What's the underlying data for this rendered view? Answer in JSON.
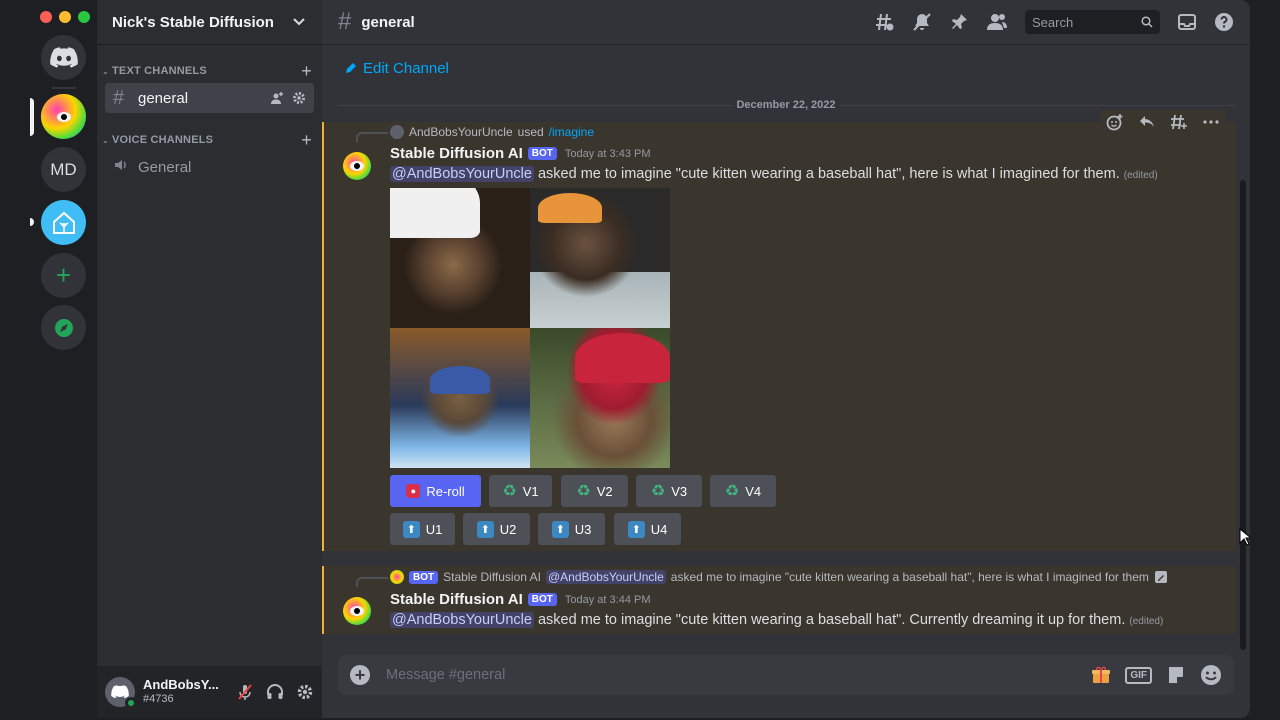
{
  "server": {
    "name": "Nick's Stable Diffusion",
    "md_label": "MD"
  },
  "sidebar": {
    "text_category": "TEXT CHANNELS",
    "voice_category": "VOICE CHANNELS",
    "channels": [
      {
        "label": "general"
      }
    ],
    "voice_channels": [
      {
        "label": "General"
      }
    ]
  },
  "user": {
    "name": "AndBobsY...",
    "tag": "#4736"
  },
  "header": {
    "channel": "general",
    "search_placeholder": "Search"
  },
  "main": {
    "edit_channel": "Edit Channel",
    "date_divider": "December 22, 2022",
    "messages": [
      {
        "reply_user": "AndBobsYourUncle",
        "reply_used": "used",
        "reply_command": "/imagine",
        "author": "Stable Diffusion AI",
        "bot_badge": "BOT",
        "time": "Today at 3:43 PM",
        "mention": "@AndBobsYourUncle",
        "text": "asked me to imagine \"cute kitten wearing a baseball hat\", here is what I imagined for them.",
        "edited": "(edited)",
        "buttons_row1": [
          "Re-roll",
          "V1",
          "V2",
          "V3",
          "V4"
        ],
        "buttons_row2": [
          "U1",
          "U2",
          "U3",
          "U4"
        ]
      },
      {
        "reply_badge": "BOT",
        "reply_author": "Stable Diffusion AI",
        "reply_mention": "@AndBobsYourUncle",
        "reply_text": "asked me to imagine \"cute kitten wearing a baseball hat\", here is what I imagined for them",
        "author": "Stable Diffusion AI",
        "bot_badge": "BOT",
        "time": "Today at 3:44 PM",
        "mention": "@AndBobsYourUncle",
        "text": "asked me to imagine \"cute kitten wearing a baseball hat\". Currently dreaming it up for them.",
        "edited": "(edited)"
      }
    ]
  },
  "composer": {
    "placeholder": "Message #general",
    "gif_label": "GIF"
  },
  "colors": {
    "accent": "#5865f2",
    "link": "#00a8fc",
    "highlight_border": "#f0b232",
    "online": "#23a559"
  }
}
